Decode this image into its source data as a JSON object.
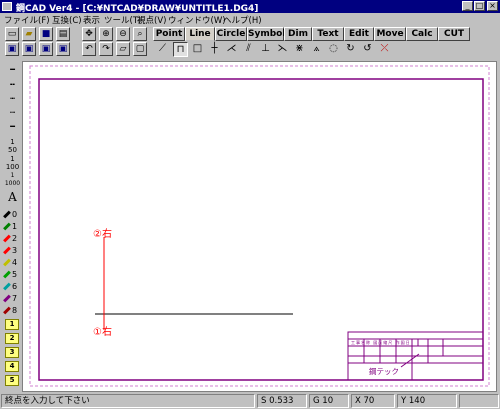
{
  "window": {
    "title": "鋼CAD Ver4 - [C:¥NTCAD¥DRAW¥UNTITLE1.DG4]",
    "btn_min": "_",
    "btn_max": "□",
    "btn_close": "×"
  },
  "menu": [
    "ファイル(F)",
    "互換(C)",
    "表示",
    "ツール(T)",
    "視点(V)",
    "ウィンドウ(W)",
    "ヘルプ(H)"
  ],
  "tabs": [
    "Point",
    "Line",
    "Circle",
    "Symbol",
    "Dim",
    "Text",
    "Edit",
    "Move",
    "Calc",
    "CUT"
  ],
  "active_tab": "Line",
  "text_tool_label": "A",
  "pens": [
    "0",
    "1",
    "2",
    "3",
    "4",
    "5",
    "6",
    "7",
    "8"
  ],
  "pen_colors": [
    "#000000",
    "#008000",
    "#ff0000",
    "#ff0000",
    "#c0c000",
    "#00a000",
    "#00a0a0",
    "#800080",
    "#a00000"
  ],
  "layers": [
    "1",
    "2",
    "3",
    "4",
    "5"
  ],
  "drawing": {
    "label_top": "②右",
    "label_bottom": "①右",
    "title_block_text": "鋼テック",
    "title_block_cells": [
      "工",
      "事",
      "名",
      "称",
      "図",
      "面",
      "縮",
      "尺",
      "作",
      "図",
      "日"
    ]
  },
  "status": {
    "prompt": "終点を入力して下さい",
    "s": "S 0.533",
    "g": "G 10",
    "x": "X 70",
    "y": "Y 140"
  },
  "colors": {
    "frame": "#800080",
    "annotation": "#ff0000",
    "title_bar": "#000080"
  }
}
